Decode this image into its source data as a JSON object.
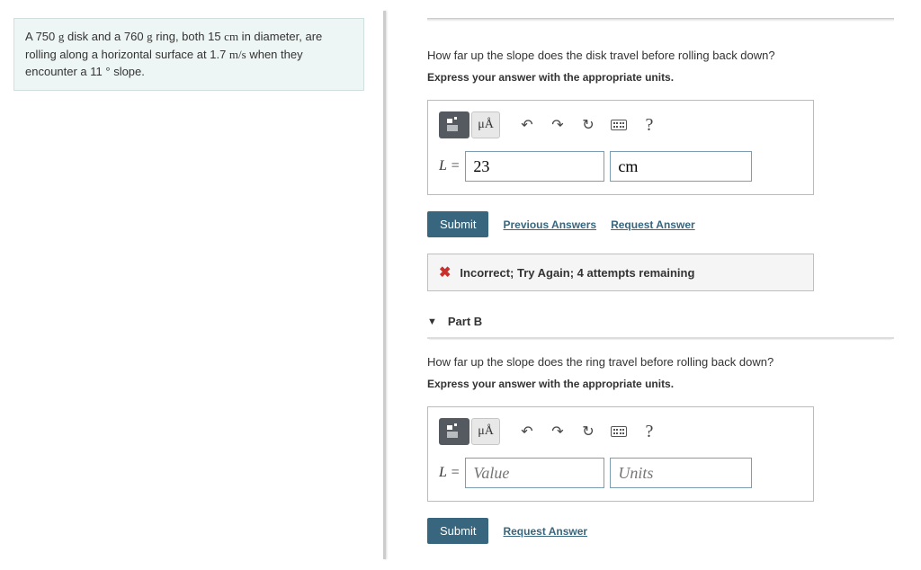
{
  "problem": {
    "text_parts": [
      "A 750 ",
      " disk and a 760 ",
      " ring, both 15 ",
      " in diameter, are rolling along a horizontal surface at 1.7 ",
      " when they encounter a 11 ° slope."
    ],
    "units": [
      "g",
      "g",
      "cm",
      "m/s"
    ]
  },
  "partA": {
    "question": "How far up the slope does the disk travel before rolling back down?",
    "instruction": "Express your answer with the appropriate units.",
    "toolbar": {
      "mu_label": "μÅ",
      "help": "?"
    },
    "label": "L",
    "value": "23",
    "unit": "cm",
    "submit": "Submit",
    "prev_answers": "Previous Answers",
    "request_answer": "Request Answer",
    "feedback": "Incorrect; Try Again; 4 attempts remaining"
  },
  "partB": {
    "header": "Part B",
    "question": "How far up the slope does the ring travel before rolling back down?",
    "instruction": "Express your answer with the appropriate units.",
    "toolbar": {
      "mu_label": "μÅ",
      "help": "?"
    },
    "label": "L",
    "value_placeholder": "Value",
    "unit_placeholder": "Units",
    "submit": "Submit",
    "request_answer": "Request Answer"
  }
}
